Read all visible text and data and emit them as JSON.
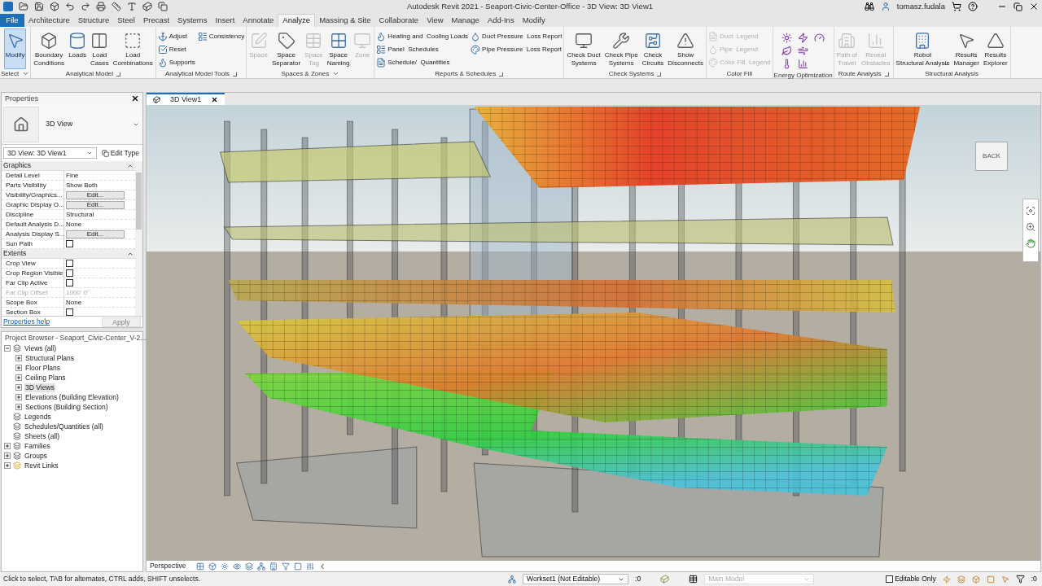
{
  "title_bar": {
    "title": "Autodesk Revit 2021 - Seaport-Civic-Center-Office - 3D View: 3D View1",
    "user": "tomasz.fudala"
  },
  "file_tab": "File",
  "ribbon_tabs": [
    {
      "label": "Architecture",
      "selected": false
    },
    {
      "label": "Structure",
      "selected": false
    },
    {
      "label": "Steel",
      "selected": false
    },
    {
      "label": "Precast",
      "selected": false
    },
    {
      "label": "Systems",
      "selected": false
    },
    {
      "label": "Insert",
      "selected": false
    },
    {
      "label": "Annotate",
      "selected": false
    },
    {
      "label": "Analyze",
      "selected": true
    },
    {
      "label": "Massing & Site",
      "selected": false
    },
    {
      "label": "Collaborate",
      "selected": false
    },
    {
      "label": "View",
      "selected": false
    },
    {
      "label": "Manage",
      "selected": false
    },
    {
      "label": "Add-Ins",
      "selected": false
    },
    {
      "label": "Modify",
      "selected": false
    }
  ],
  "ribbon_panels": [
    {
      "title": "Select",
      "menu": true,
      "launcher": false,
      "items": [
        {
          "kind": "large",
          "label": "Modify",
          "active": true,
          "disabled": false
        }
      ]
    },
    {
      "title": "Analytical Model",
      "menu": false,
      "launcher": true,
      "items": [
        {
          "kind": "large",
          "label": "Boundary\nConditions",
          "disabled": false
        },
        {
          "kind": "large",
          "label": "Loads",
          "disabled": false
        },
        {
          "kind": "large",
          "label": "Load\nCases",
          "disabled": false
        },
        {
          "kind": "large",
          "label": "Load\nCombinations",
          "disabled": false
        }
      ]
    },
    {
      "title": "Analytical Model Tools",
      "menu": false,
      "launcher": true,
      "items": [
        {
          "kind": "small",
          "label": "Adjust",
          "disabled": false
        },
        {
          "kind": "small",
          "label": "Reset",
          "disabled": false
        },
        {
          "kind": "small",
          "label": "Supports",
          "disabled": false
        },
        {
          "kind": "small",
          "label": "Consistency",
          "disabled": false
        }
      ]
    },
    {
      "title": "Spaces & Zones",
      "menu": true,
      "launcher": false,
      "items": [
        {
          "kind": "large",
          "label": "Space",
          "disabled": true
        },
        {
          "kind": "large",
          "label": "Space\nSeparator",
          "disabled": false
        },
        {
          "kind": "large",
          "label": "Space\nTag",
          "disabled": true
        },
        {
          "kind": "large",
          "label": "Space\nNaming",
          "disabled": false
        },
        {
          "kind": "large",
          "label": "Zone",
          "disabled": true
        }
      ]
    },
    {
      "title": "Reports & Schedules",
      "menu": false,
      "launcher": true,
      "items": [
        {
          "kind": "small",
          "label": "Heating and  Cooling Loads",
          "disabled": false
        },
        {
          "kind": "small",
          "label": "Panel  Schedules",
          "disabled": false
        },
        {
          "kind": "small",
          "label": "Schedule/  Quantities",
          "disabled": false
        },
        {
          "kind": "small",
          "label": "Duct Pressure  Loss Report",
          "disabled": false
        },
        {
          "kind": "small",
          "label": "Pipe Pressure  Loss Report",
          "disabled": false
        }
      ]
    },
    {
      "title": "Check Systems",
      "menu": false,
      "launcher": true,
      "items": [
        {
          "kind": "large",
          "label": "Check Duct\nSystems",
          "disabled": false
        },
        {
          "kind": "large",
          "label": "Check Pipe\nSystems",
          "disabled": false
        },
        {
          "kind": "large",
          "label": "Check\nCircuits",
          "disabled": false
        },
        {
          "kind": "large",
          "label": "Show\nDisconnects",
          "disabled": false
        }
      ]
    },
    {
      "title": "Color Fill",
      "menu": false,
      "launcher": false,
      "items": [
        {
          "kind": "small",
          "label": "Duct  Legend",
          "disabled": true
        },
        {
          "kind": "small",
          "label": "Pipe  Legend",
          "disabled": true
        },
        {
          "kind": "small",
          "label": "Color Fill  Legend",
          "disabled": true
        }
      ]
    },
    {
      "title": "Energy Optimization",
      "menu": false,
      "launcher": false,
      "items": [
        {
          "kind": "icon",
          "disabled": false
        },
        {
          "kind": "icon",
          "disabled": false
        },
        {
          "kind": "icon",
          "disabled": false
        },
        {
          "kind": "icon",
          "disabled": false
        },
        {
          "kind": "icon",
          "disabled": false
        },
        {
          "kind": "icon",
          "disabled": false
        },
        {
          "kind": "icon",
          "disabled": false
        }
      ]
    },
    {
      "title": "Route Analysis",
      "menu": false,
      "launcher": true,
      "items": [
        {
          "kind": "large",
          "label": "Path of\nTravel",
          "disabled": true
        },
        {
          "kind": "large",
          "label": "Reveal\nObstacles",
          "disabled": true
        }
      ]
    },
    {
      "title": "Structural Analysis",
      "menu": false,
      "launcher": false,
      "items": [
        {
          "kind": "large",
          "label": "Robot\nStructural Analysis",
          "disabled": false,
          "menu": true
        },
        {
          "kind": "large",
          "label": "Results\nManager",
          "disabled": false,
          "menu": false
        },
        {
          "kind": "large",
          "label": "Results\nExplorer",
          "disabled": false,
          "menu": false
        }
      ]
    }
  ],
  "properties": {
    "title": "Properties",
    "type_name": "3D View",
    "instance": "3D View: 3D View1",
    "edit_type": "Edit Type",
    "groups": [
      {
        "name": "Graphics",
        "rows": [
          {
            "kind": "text",
            "name": "Detail Level",
            "value": "Fine",
            "disabled": false
          },
          {
            "kind": "text",
            "name": "Parts Visibility",
            "value": "Show Both",
            "disabled": false
          },
          {
            "kind": "button",
            "name": "Visibility/Graphics...",
            "value": "Edit...",
            "disabled": false
          },
          {
            "kind": "button",
            "name": "Graphic Display O...",
            "value": "Edit...",
            "disabled": false
          },
          {
            "kind": "text",
            "name": "Discipline",
            "value": "Structural",
            "disabled": false
          },
          {
            "kind": "text",
            "name": "Default Analysis D...",
            "value": "None",
            "disabled": false
          },
          {
            "kind": "button",
            "name": "Analysis Display S...",
            "value": "Edit...",
            "disabled": false
          },
          {
            "kind": "checkbox",
            "name": "Sun Path",
            "checked": false,
            "disabled": false
          }
        ]
      },
      {
        "name": "Extents",
        "rows": [
          {
            "kind": "checkbox",
            "name": "Crop View",
            "checked": false,
            "disabled": false
          },
          {
            "kind": "checkbox",
            "name": "Crop Region Visible",
            "checked": false,
            "disabled": false
          },
          {
            "kind": "checkbox",
            "name": "Far Clip Active",
            "checked": false,
            "disabled": false
          },
          {
            "kind": "text",
            "name": "Far Clip Offset",
            "value": "1000'  0\"",
            "disabled": true
          },
          {
            "kind": "text",
            "name": "Scope Box",
            "value": "None",
            "disabled": false
          },
          {
            "kind": "checkbox",
            "name": "Section Box",
            "checked": false,
            "disabled": false
          }
        ]
      }
    ],
    "help_link": "Properties help",
    "apply": {
      "label": "Apply",
      "disabled": true
    }
  },
  "project_browser": {
    "title": "Project Browser - Seaport_Civic-Center_V-2...",
    "tree": [
      {
        "label": "Views (all)",
        "expanded": true,
        "selected": false,
        "children": [
          {
            "label": "Structural Plans",
            "expanded": false,
            "selected": false
          },
          {
            "label": "Floor Plans",
            "expanded": false,
            "selected": false
          },
          {
            "label": "Ceiling Plans",
            "expanded": false,
            "selected": false
          },
          {
            "label": "3D Views",
            "expanded": false,
            "selected": true
          },
          {
            "label": "Elevations (Building Elevation)",
            "expanded": false,
            "selected": false
          },
          {
            "label": "Sections (Building Section)",
            "expanded": false,
            "selected": false
          }
        ]
      },
      {
        "label": "Legends",
        "selected": false
      },
      {
        "label": "Schedules/Quantities (all)",
        "selected": false
      },
      {
        "label": "Sheets (all)",
        "selected": false
      },
      {
        "label": "Families",
        "expanded": false,
        "selected": false
      },
      {
        "label": "Groups",
        "expanded": false,
        "selected": false
      },
      {
        "label": "Revit Links",
        "expanded": false,
        "selected": false
      }
    ]
  },
  "view_tab": {
    "label": "3D View1"
  },
  "view_cube": {
    "face": "BACK"
  },
  "view_control_bar": {
    "mode": "Perspective"
  },
  "status_bar": {
    "message": "Click to select, TAB for alternates, CTRL adds, SHIFT unselects.",
    "workset": "Workset1 (Not Editable)",
    "workset_count": ":0",
    "design_option": "Main Model",
    "editable_only": {
      "label": "Editable Only",
      "checked": false
    },
    "filter_count": ":0"
  }
}
